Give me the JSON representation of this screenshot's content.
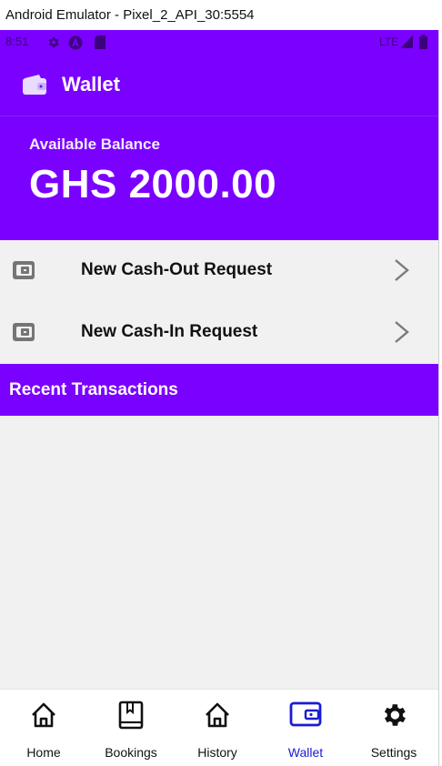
{
  "window": {
    "title": "Android Emulator - Pixel_2_API_30:5554"
  },
  "status_bar": {
    "time": "8:51",
    "network": "LTE",
    "icons": [
      "gear-icon",
      "a-icon",
      "sd-card-icon",
      "signal-icon",
      "battery-icon"
    ]
  },
  "app_bar": {
    "title": "Wallet",
    "icon": "wallet-icon"
  },
  "balance": {
    "label": "Available Balance",
    "amount": "GHS 2000.00"
  },
  "actions": [
    {
      "label": "New Cash-Out Request",
      "icon": "wallet-icon",
      "chevron": "chevron-right-icon"
    },
    {
      "label": "New Cash-In Request",
      "icon": "wallet-icon",
      "chevron": "chevron-right-icon"
    }
  ],
  "recent": {
    "title": "Recent Transactions"
  },
  "bottom_nav": {
    "items": [
      {
        "label": "Home",
        "icon": "home-icon"
      },
      {
        "label": "Bookings",
        "icon": "bookmark-book-icon"
      },
      {
        "label": "History",
        "icon": "home-icon"
      },
      {
        "label": "Wallet",
        "icon": "wallet-icon"
      },
      {
        "label": "Settings",
        "icon": "gear-icon"
      }
    ],
    "active": "Wallet"
  },
  "colors": {
    "primary": "#7a00ff",
    "active_nav": "#1a1ad6",
    "background": "#f1f1f1"
  }
}
